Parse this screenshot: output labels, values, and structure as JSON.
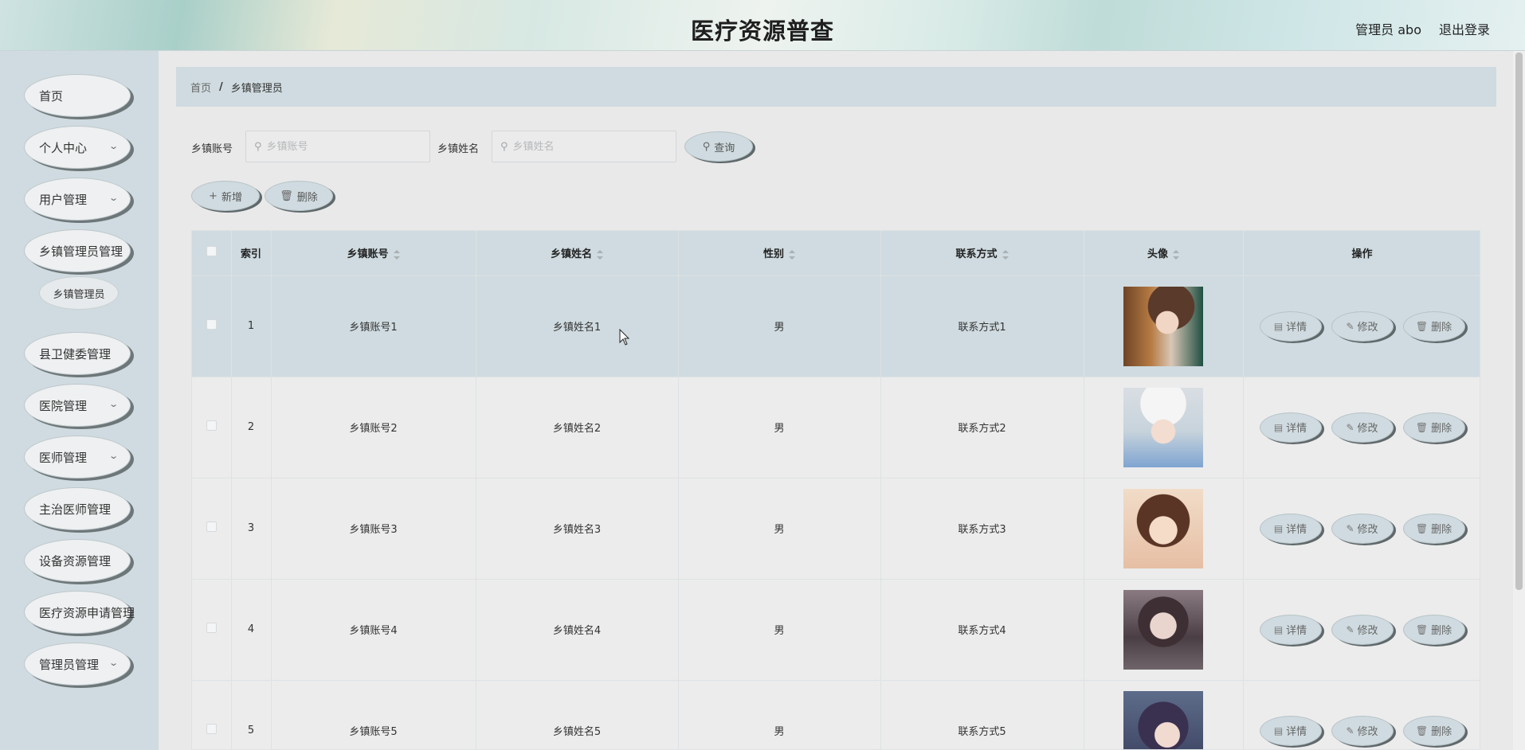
{
  "header": {
    "title": "医疗资源普查",
    "user": "管理员 abo",
    "logout": "退出登录"
  },
  "sidebar": {
    "items": [
      {
        "label": "首页",
        "has_chevron": false
      },
      {
        "label": "个人中心",
        "has_chevron": true
      },
      {
        "label": "用户管理",
        "has_chevron": true
      },
      {
        "label": "乡镇管理员管理",
        "has_chevron": false
      },
      {
        "label": "县卫健委管理",
        "has_chevron": false
      },
      {
        "label": "医院管理",
        "has_chevron": true
      },
      {
        "label": "医师管理",
        "has_chevron": true
      },
      {
        "label": "主治医师管理",
        "has_chevron": false
      },
      {
        "label": "设备资源管理",
        "has_chevron": false
      },
      {
        "label": "医疗资源申请管理",
        "has_chevron": false
      },
      {
        "label": "管理员管理",
        "has_chevron": true
      }
    ],
    "submenu": {
      "label": "乡镇管理员"
    },
    "chevron": "⌄"
  },
  "breadcrumb": {
    "home": "首页",
    "sep": "/",
    "current": "乡镇管理员"
  },
  "search": {
    "account_label": "乡镇账号",
    "account_placeholder": "乡镇账号",
    "account_value": "",
    "name_label": "乡镇姓名",
    "name_placeholder": "乡镇姓名",
    "name_value": "",
    "query_label": "查询",
    "search_icon": "⚲"
  },
  "actions": {
    "add_label": "新增",
    "delete_label": "删除",
    "add_icon": "+",
    "delete_icon": "🗑"
  },
  "table": {
    "columns": {
      "index": "索引",
      "account": "乡镇账号",
      "name": "乡镇姓名",
      "gender": "性别",
      "contact": "联系方式",
      "avatar": "头像",
      "ops": "操作"
    },
    "rows": [
      {
        "index": "1",
        "account": "乡镇账号1",
        "name": "乡镇姓名1",
        "gender": "男",
        "contact": "联系方式1"
      },
      {
        "index": "2",
        "account": "乡镇账号2",
        "name": "乡镇姓名2",
        "gender": "男",
        "contact": "联系方式2"
      },
      {
        "index": "3",
        "account": "乡镇账号3",
        "name": "乡镇姓名3",
        "gender": "男",
        "contact": "联系方式3"
      },
      {
        "index": "4",
        "account": "乡镇账号4",
        "name": "乡镇姓名4",
        "gender": "男",
        "contact": "联系方式4"
      },
      {
        "index": "5",
        "account": "乡镇账号5",
        "name": "乡镇姓名5",
        "gender": "男",
        "contact": "联系方式5"
      }
    ],
    "ops": {
      "detail": "详情",
      "edit": "修改",
      "delete": "删除"
    },
    "op_icons": {
      "detail": "▤",
      "edit": "✎",
      "delete": "🗑"
    }
  },
  "colors": {
    "accent": "#cfdbe0",
    "shadow": "#5f686b",
    "background": "#e9e9e9"
  }
}
